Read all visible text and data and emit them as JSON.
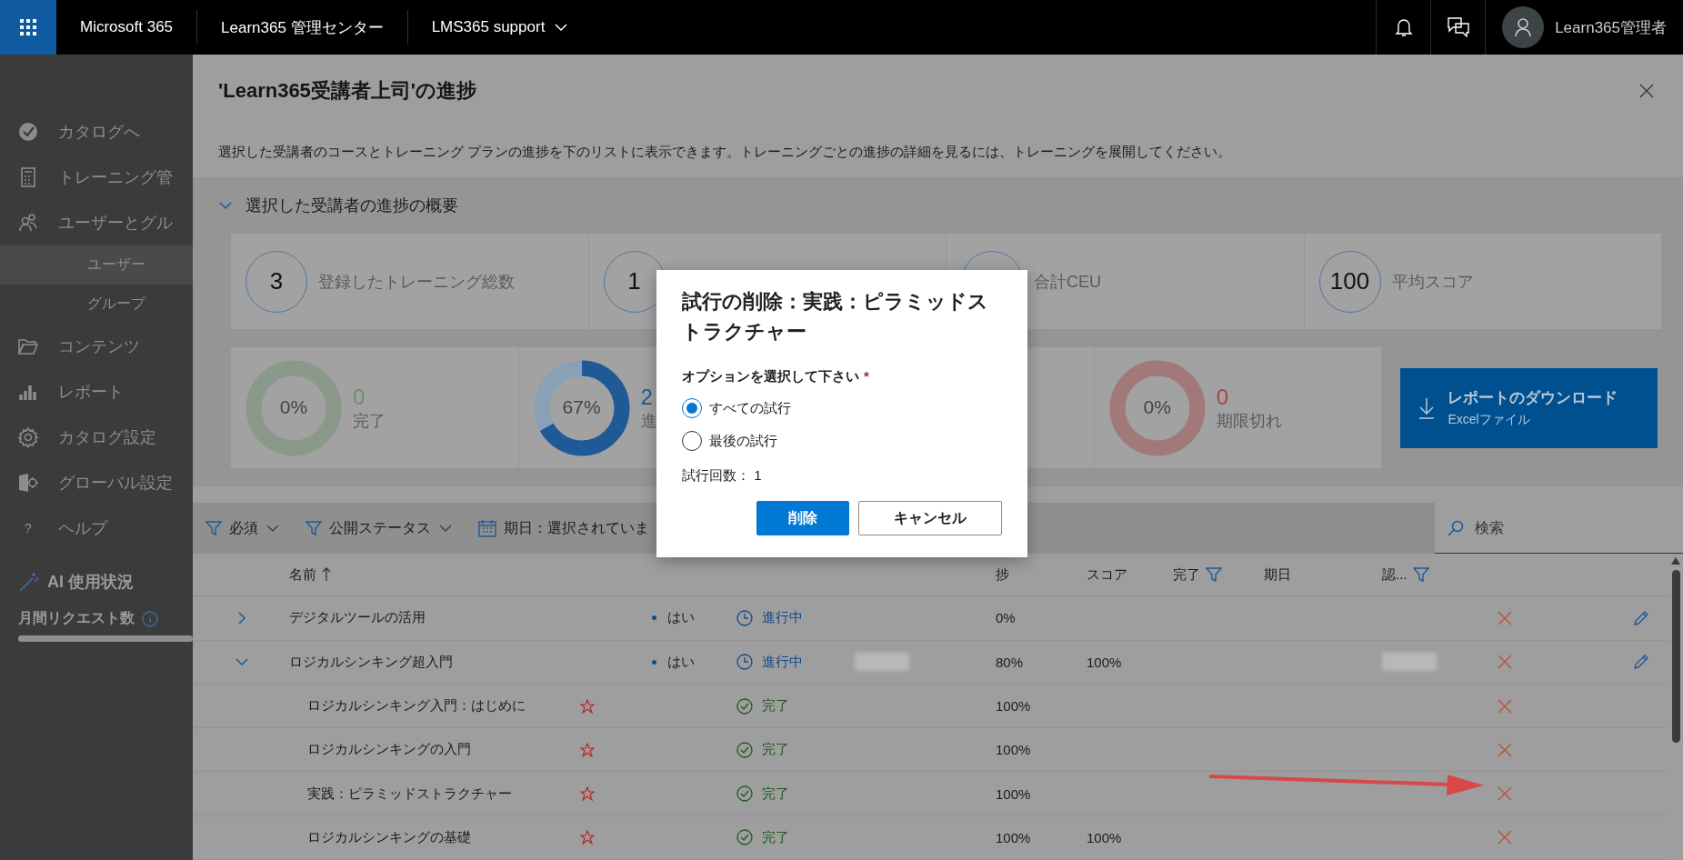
{
  "topbar": {
    "brand": "Microsoft 365",
    "app": "Learn365 管理センター",
    "tenant": "LMS365 support",
    "user": "Learn365管理者"
  },
  "sidebar": {
    "items": [
      {
        "kind": "check",
        "label": "カタログへ",
        "selected": false
      },
      {
        "kind": "calc",
        "label": "トレーニング管",
        "selected": false
      },
      {
        "kind": "users",
        "label": "ユーザーとグル",
        "selected": false,
        "children": [
          {
            "label": "ユーザー",
            "selected": true
          },
          {
            "label": "グループ",
            "selected": false
          }
        ]
      },
      {
        "kind": "folder",
        "label": "コンテンツ",
        "selected": false
      },
      {
        "kind": "chart",
        "label": "レポート",
        "selected": false
      },
      {
        "kind": "gear",
        "label": "カタログ設定",
        "selected": false
      },
      {
        "kind": "global",
        "label": "グローバル設定",
        "selected": false
      },
      {
        "kind": "help",
        "icon": "?",
        "label": "ヘルプ",
        "selected": false
      }
    ],
    "ai": {
      "title": "AI 使用状況",
      "meter_label": "月間リクエスト数",
      "level": 1
    }
  },
  "panel": {
    "title": "'Learn365受講者上司'の進捗",
    "description": "選択した受講者のコースとトレーニング プランの進捗を下のリストに表示できます。トレーニングごとの進捗の詳細を見るには、トレーニングを展開してください。",
    "summary": {
      "heading": "選択した受講者の進捗の概要",
      "expanded": true,
      "stats": [
        {
          "number": "3",
          "label": "登録したトレーニング総数"
        },
        {
          "number": "1"
        },
        {
          "label": "合計CEU"
        },
        {
          "number": "100",
          "label": "平均スコア"
        }
      ],
      "donuts": [
        {
          "percent": "0%",
          "count": "0",
          "label": "完了",
          "level": 0,
          "color": "#6f8f6f"
        },
        {
          "percent": "67%",
          "count": "2",
          "label": "進",
          "level": 0.67,
          "color": "#1f5a96"
        },
        {
          "percent": "0%",
          "count": "0",
          "label": "期限切れ",
          "level": 0,
          "color": "#a04848"
        }
      ],
      "download": {
        "title": "レポートのダウンロード",
        "subtitle": "Excelファイル"
      }
    },
    "filters": [
      {
        "kind": "funnel",
        "label": "必須"
      },
      {
        "kind": "funnel",
        "label": "公開ステータス"
      },
      {
        "kind": "calendar",
        "label": "期日：選択されていま"
      }
    ],
    "search": {
      "placeholder": "検索"
    },
    "columns": [
      {
        "label": "名前",
        "sorted": true,
        "filter": false
      },
      {
        "label": "捗",
        "sorted": false,
        "filter": false
      },
      {
        "label": "スコア",
        "sorted": false,
        "filter": false
      },
      {
        "label": "完了",
        "sorted": false,
        "filter": true
      },
      {
        "label": "期日",
        "sorted": false,
        "filter": false
      },
      {
        "label": "認...",
        "sorted": false,
        "filter": true
      }
    ],
    "rows": [
      {
        "name": "デジタルツールの活用",
        "expanded": false,
        "required": "はい",
        "status": "進行中",
        "done": false,
        "progress": "0%",
        "blurred": false,
        "editable": true
      },
      {
        "name": "ロジカルシンキング超入門",
        "expanded": true,
        "required": "はい",
        "status": "進行中",
        "done": false,
        "progress": "80%",
        "score": "100%",
        "blurred": true,
        "editable": true,
        "children": [
          {
            "name": "ロジカルシンキング入門：はじめに",
            "status": "完了",
            "done": true,
            "progress": "100%"
          },
          {
            "name": "ロジカルシンキングの入門",
            "status": "完了",
            "done": true,
            "progress": "100%"
          },
          {
            "name": "実践：ピラミッドストラクチャー",
            "status": "完了",
            "done": true,
            "progress": "100%"
          },
          {
            "name": "ロジカルシンキングの基礎",
            "status": "完了",
            "done": true,
            "progress": "100%",
            "score": "100%"
          }
        ]
      }
    ]
  },
  "dialog": {
    "title": "試行の削除：実践：ピラミッドストラクチャー",
    "prompt": "オプションを選択して下さい",
    "required_mark": "*",
    "options": [
      {
        "label": "すべての試行",
        "selected": true
      },
      {
        "label": "最後の試行",
        "selected": false
      }
    ],
    "attempts": "試行回数： 1",
    "buttons": [
      {
        "kind": "primary",
        "label": "削除"
      },
      {
        "kind": "secondary",
        "label": "キャンセル"
      }
    ]
  }
}
